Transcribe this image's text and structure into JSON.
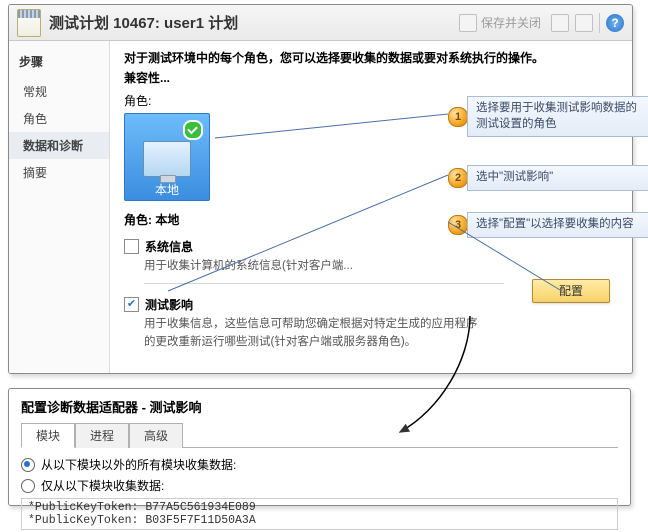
{
  "title": "测试计划 10467: user1 计划",
  "toolbar": {
    "save_close": "保存并关闭"
  },
  "sidebar": {
    "header": "步骤",
    "items": [
      "常规",
      "角色",
      "数据和诊断",
      "摘要"
    ],
    "selected": 2
  },
  "main": {
    "intro": "对于测试环境中的每个角色，您可以选择要收集的数据或要对系统执行的操作。",
    "compat": "兼容性...",
    "role_label": "角色:",
    "role_tile": "本地",
    "section_label": "角色: 本地",
    "opt1": {
      "label": "系统信息",
      "desc": "用于收集计算机的系统信息(针对客户端..."
    },
    "opt2": {
      "label": "测试影响",
      "desc": "用于收集信息，这些信息可帮助您确定根据对特定生成的应用程序的更改重新运行哪些测试(针对客户端或服务器角色)。"
    },
    "configure": "配置"
  },
  "callouts": {
    "c1": "选择要用于收集测试影响数据的测试设置的角色",
    "c2": "选中\"测试影响\"",
    "c3": "选择\"配置\"以选择要收集的内容"
  },
  "panel2": {
    "title": "配置诊断数据适配器 - 测试影响",
    "tabs": [
      "模块",
      "进程",
      "高级"
    ],
    "r1": "从以下模块以外的所有模块收集数据:",
    "r2": "仅从以下模块收集数据:",
    "pk": [
      "*PublicKeyToken: B77A5C561934E089",
      "*PublicKeyToken: B03F5F7F11D50A3A"
    ]
  }
}
